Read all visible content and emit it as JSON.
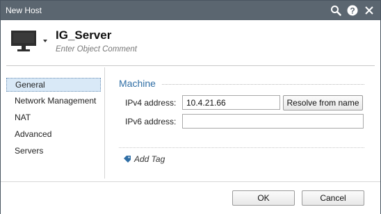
{
  "window": {
    "title": "New Host"
  },
  "titlebar": {
    "icons": [
      "search-icon",
      "help-icon",
      "close-icon"
    ]
  },
  "object": {
    "name": "IG_Server",
    "comment_placeholder": "Enter Object Comment"
  },
  "nav": {
    "items": [
      {
        "label": "General",
        "selected": true
      },
      {
        "label": "Network Management",
        "selected": false
      },
      {
        "label": "NAT",
        "selected": false
      },
      {
        "label": "Advanced",
        "selected": false
      },
      {
        "label": "Servers",
        "selected": false
      }
    ]
  },
  "machine": {
    "section_title": "Machine",
    "ipv4_label": "IPv4 address:",
    "ipv4_value": "10.4.21.66",
    "ipv6_label": "IPv6 address:",
    "ipv6_value": "",
    "resolve_label": "Resolve from name"
  },
  "tags": {
    "add_label": "Add Tag"
  },
  "footer": {
    "ok_label": "OK",
    "cancel_label": "Cancel"
  },
  "colors": {
    "titlebar": "#5b6670",
    "accent": "#2f6ea5",
    "selection": "#d9e9f7"
  }
}
